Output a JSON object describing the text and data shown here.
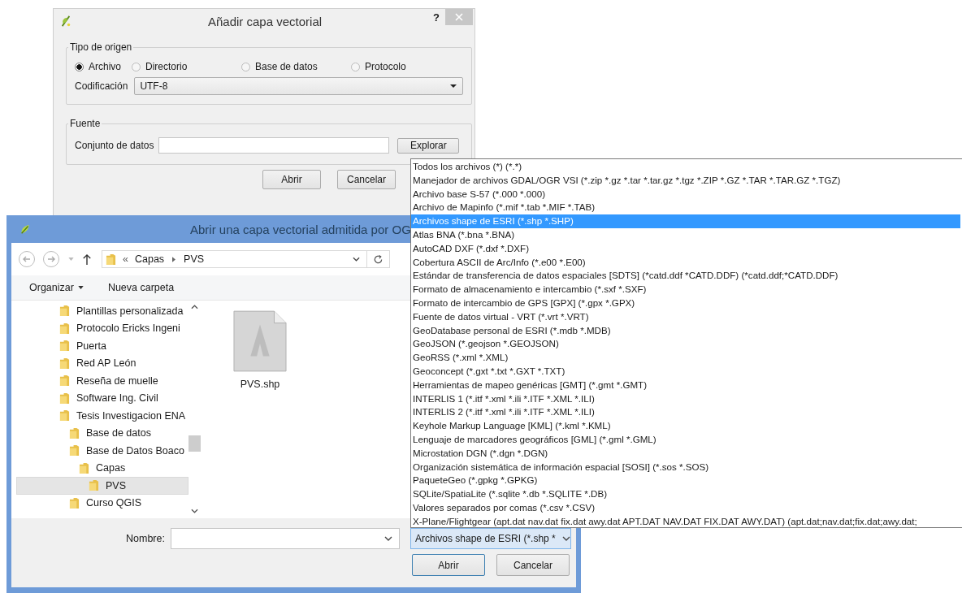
{
  "add_layer_dialog": {
    "title": "Añadir capa vectorial",
    "help": "?",
    "source_type": {
      "legend": "Tipo de origen",
      "options": [
        {
          "label": "Archivo",
          "selected": true
        },
        {
          "label": "Directorio",
          "selected": false
        },
        {
          "label": "Base de datos",
          "selected": false
        },
        {
          "label": "Protocolo",
          "selected": false
        }
      ],
      "encoding_label": "Codificación",
      "encoding_value": "UTF-8"
    },
    "source": {
      "legend": "Fuente",
      "dataset_label": "Conjunto de datos",
      "browse_button": "Explorar"
    },
    "buttons": [
      "Abrir",
      "Cancelar"
    ]
  },
  "open_dialog": {
    "title": "Abrir una capa vectorial admitida por OG",
    "path_prefix": "«",
    "path": [
      "Capas",
      "PVS"
    ],
    "toolbar": {
      "organize": "Organizar",
      "new_folder": "Nueva carpeta"
    },
    "tree": [
      {
        "label": "Plantillas personalizada",
        "selected": false
      },
      {
        "label": "Protocolo Ericks Ingeni",
        "selected": false
      },
      {
        "label": "Puerta",
        "selected": false
      },
      {
        "label": "Red AP León",
        "selected": false
      },
      {
        "label": "Reseña de muelle",
        "selected": false
      },
      {
        "label": "Software Ing. Civil",
        "selected": false
      },
      {
        "label": "Tesis Investigacion ENA",
        "selected": false,
        "children": [
          {
            "label": "Base de datos",
            "selected": false
          },
          {
            "label": "Base de Datos Boaco",
            "selected": false,
            "children": [
              {
                "label": "Capas",
                "selected": false,
                "children": [
                  {
                    "label": "PVS",
                    "selected": true
                  }
                ]
              }
            ]
          },
          {
            "label": "Curso QGIS",
            "selected": false
          }
        ]
      }
    ],
    "files": [
      {
        "name": "PVS.shp"
      }
    ],
    "name_label": "Nombre:",
    "file_type": "Archivos shape de ESRI (*.shp *",
    "buttons": [
      "Abrir",
      "Cancelar"
    ]
  },
  "file_type_list": [
    {
      "label": "Todos los archivos (*) (*.*)",
      "selected": false
    },
    {
      "label": "Manejador de archivos GDAL/OGR VSI  (*.zip *.gz *.tar *.tar.gz *.tgz *.ZIP *.GZ *.TAR *.TAR.GZ *.TGZ)",
      "selected": false
    },
    {
      "label": "Archivo base S-57 (*.000 *.000)",
      "selected": false
    },
    {
      "label": "Archivo de Mapinfo (*.mif *.tab *.MIF *.TAB)",
      "selected": false
    },
    {
      "label": "Archivos shape de ESRI (*.shp *.SHP)",
      "selected": true
    },
    {
      "label": "Atlas BNA (*.bna *.BNA)",
      "selected": false
    },
    {
      "label": "AutoCAD DXF (*.dxf *.DXF)",
      "selected": false
    },
    {
      "label": "Cobertura ASCII de Arc/Info (*.e00 *.E00)",
      "selected": false
    },
    {
      "label": "Estándar de transferencia de datos espaciales [SDTS] (*catd.ddf *CATD.DDF) (*catd.ddf;*CATD.DDF)",
      "selected": false
    },
    {
      "label": "Formato de almacenamiento e intercambio (*.sxf *.SXF)",
      "selected": false
    },
    {
      "label": "Formato de intercambio de GPS [GPX] (*.gpx *.GPX)",
      "selected": false
    },
    {
      "label": "Fuente de datos virtual - VRT (*.vrt *.VRT)",
      "selected": false
    },
    {
      "label": "GeoDatabase personal de ESRI (*.mdb *.MDB)",
      "selected": false
    },
    {
      "label": "GeoJSON (*.geojson *.GEOJSON)",
      "selected": false
    },
    {
      "label": "GeoRSS (*.xml *.XML)",
      "selected": false
    },
    {
      "label": "Geoconcept (*.gxt *.txt *.GXT *.TXT)",
      "selected": false
    },
    {
      "label": "Herramientas de mapeo genéricas [GMT] (*.gmt *.GMT)",
      "selected": false
    },
    {
      "label": "INTERLIS 1 (*.itf *.xml *.ili *.ITF *.XML *.ILI)",
      "selected": false
    },
    {
      "label": "INTERLIS 2 (*.itf *.xml *.ili *.ITF *.XML *.ILI)",
      "selected": false
    },
    {
      "label": "Keyhole Markup Language [KML] (*.kml *.KML)",
      "selected": false
    },
    {
      "label": "Lenguaje de marcadores geográficos [GML] (*.gml *.GML)",
      "selected": false
    },
    {
      "label": "Microstation DGN (*.dgn *.DGN)",
      "selected": false
    },
    {
      "label": "Organización sistemática de información espacial [SOSI] (*.sos *.SOS)",
      "selected": false
    },
    {
      "label": "PaqueteGeo (*.gpkg *.GPKG)",
      "selected": false
    },
    {
      "label": "SQLite/SpatiaLite (*.sqlite *.db *.SQLITE *.DB)",
      "selected": false
    },
    {
      "label": "Valores separados por comas (*.csv *.CSV)",
      "selected": false
    },
    {
      "label": "X-Plane/Flightgear (apt.dat nav.dat fix.dat awy.dat APT.DAT NAV.DAT FIX.DAT AWY.DAT) (apt.dat;nav.dat;fix.dat;awy.dat;",
      "selected": false
    }
  ]
}
